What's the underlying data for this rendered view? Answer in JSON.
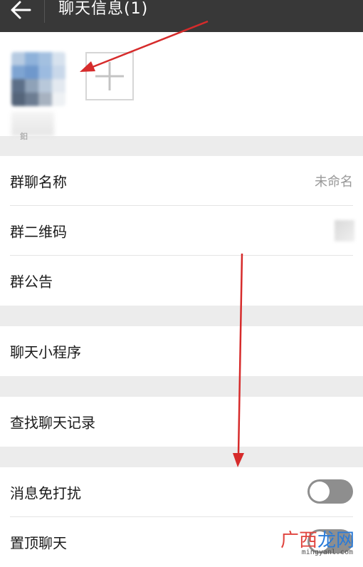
{
  "header": {
    "back_icon": "back-arrow-icon",
    "title": "聊天信息(1)"
  },
  "members": {
    "avatar_caption": "鈤",
    "add_icon": "plus-icon"
  },
  "settings": {
    "group_name": {
      "label": "群聊名称",
      "value": "未命名"
    },
    "qr_code": {
      "label": "群二维码"
    },
    "announcement": {
      "label": "群公告"
    },
    "mini_programs": {
      "label": "聊天小程序"
    },
    "search_history": {
      "label": "查找聊天记录"
    },
    "mute": {
      "label": "消息免打扰",
      "enabled": false
    },
    "pin": {
      "label": "置顶聊天",
      "enabled": false
    }
  },
  "watermark": {
    "main_a": "广西",
    "main_b": "龙网",
    "sub": "mingyanl.com"
  },
  "colors": {
    "topbar": "#383838",
    "annotation_arrow": "#d62b2b",
    "toggle_off": "#8e8e8e",
    "background": "#ececec"
  }
}
